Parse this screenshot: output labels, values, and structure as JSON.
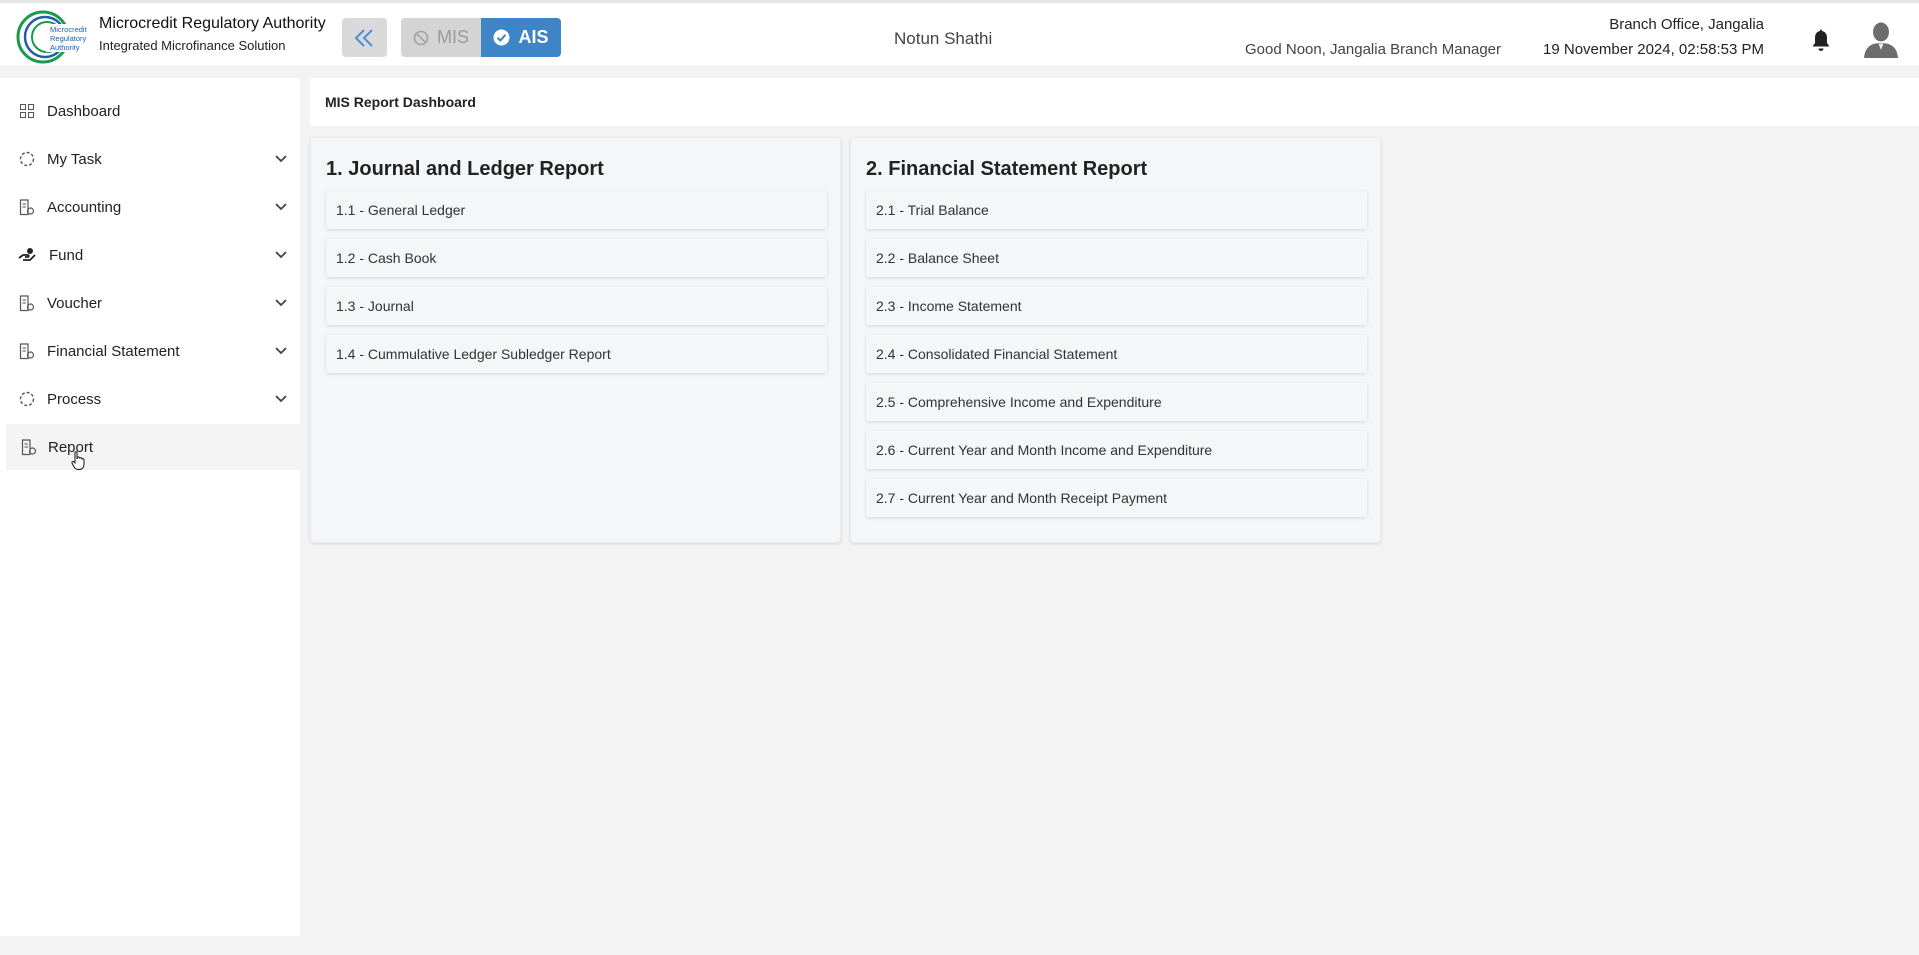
{
  "header": {
    "org_title": "Microcredit Regulatory Authority",
    "org_subtitle": "Integrated Microfinance Solution",
    "logo_text": "Microcredit Regulatory Authority",
    "mode_mis": "MIS",
    "mode_ais": "AIS",
    "active_mode": "AIS",
    "center_title": "Notun Shathi",
    "greeting": "Good Noon, Jangalia Branch Manager",
    "branch": "Branch Office, Jangalia",
    "datetime": "19 November 2024, 02:58:53 PM"
  },
  "sidebar": {
    "items": [
      {
        "label": "Dashboard",
        "icon": "grid-icon",
        "has_chevron": false
      },
      {
        "label": "My Task",
        "icon": "dashed-circle-icon",
        "has_chevron": true
      },
      {
        "label": "Accounting",
        "icon": "document-icon",
        "has_chevron": true
      },
      {
        "label": "Fund",
        "icon": "hand-coin-icon",
        "has_chevron": true
      },
      {
        "label": "Voucher",
        "icon": "document-icon",
        "has_chevron": true
      },
      {
        "label": "Financial Statement",
        "icon": "document-icon",
        "has_chevron": true
      },
      {
        "label": "Process",
        "icon": "dashed-circle-icon",
        "has_chevron": true
      },
      {
        "label": "Report",
        "icon": "document-icon",
        "has_chevron": false,
        "active": true
      }
    ]
  },
  "main": {
    "breadcrumb": "MIS Report Dashboard",
    "cards": [
      {
        "title": "1. Journal and Ledger Report",
        "items": [
          "1.1 - General Ledger",
          "1.2 - Cash Book",
          "1.3 - Journal",
          "1.4 - Cummulative Ledger Subledger Report"
        ]
      },
      {
        "title": "2. Financial Statement Report",
        "items": [
          "2.1 - Trial Balance",
          "2.2 - Balance Sheet",
          "2.3 - Income Statement",
          "2.4 - Consolidated Financial Statement",
          "2.5 - Comprehensive Income and Expenditure",
          "2.6 - Current Year and Month Income and Expenditure",
          "2.7 - Current Year and Month Receipt Payment"
        ]
      }
    ]
  },
  "colors": {
    "accent": "#3d85c6",
    "logo_green": "#1a9b4b",
    "logo_blue": "#1f5fa8",
    "background": "#f3f3f3"
  }
}
